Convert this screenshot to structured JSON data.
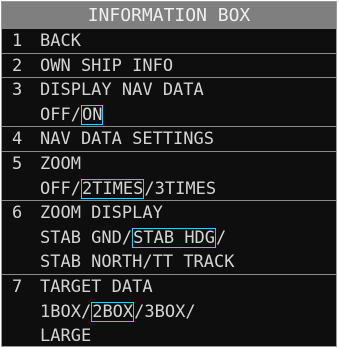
{
  "menu": {
    "title": "INFORMATION BOX",
    "items": [
      {
        "num": "1",
        "label": "BACK"
      },
      {
        "num": "2",
        "label": "OWN SHIP INFO"
      },
      {
        "num": "3",
        "label": "DISPLAY NAV DATA",
        "options_line1": {
          "a": "OFF",
          "s1": "/",
          "b": "ON"
        }
      },
      {
        "num": "4",
        "label": "NAV DATA SETTINGS"
      },
      {
        "num": "5",
        "label": "ZOOM",
        "options_line1": {
          "a": "OFF",
          "s1": "/",
          "b": "2TIMES",
          "s2": "/",
          "c": "3TIMES"
        }
      },
      {
        "num": "6",
        "label": "ZOOM DISPLAY",
        "options_line1": {
          "a": "STAB GND",
          "s1": "/",
          "b": "STAB HDG",
          "s2": "/"
        },
        "options_line2": {
          "a": "STAB NORTH",
          "s1": "/",
          "b": "TT TRACK"
        }
      },
      {
        "num": "7",
        "label": "TARGET DATA",
        "options_line1": {
          "a": "1BOX",
          "s1": "/",
          "b": "2BOX",
          "s2": "/",
          "c": "3BOX",
          "s3": "/"
        },
        "options_line2": {
          "a": "LARGE"
        }
      }
    ],
    "colors": {
      "background": "#0e0e0e",
      "title_bar": "#7f7f7f",
      "text": "#d4d4d4",
      "selected_outline": "#3ec7e6",
      "separator": "#8a8a8a"
    }
  }
}
